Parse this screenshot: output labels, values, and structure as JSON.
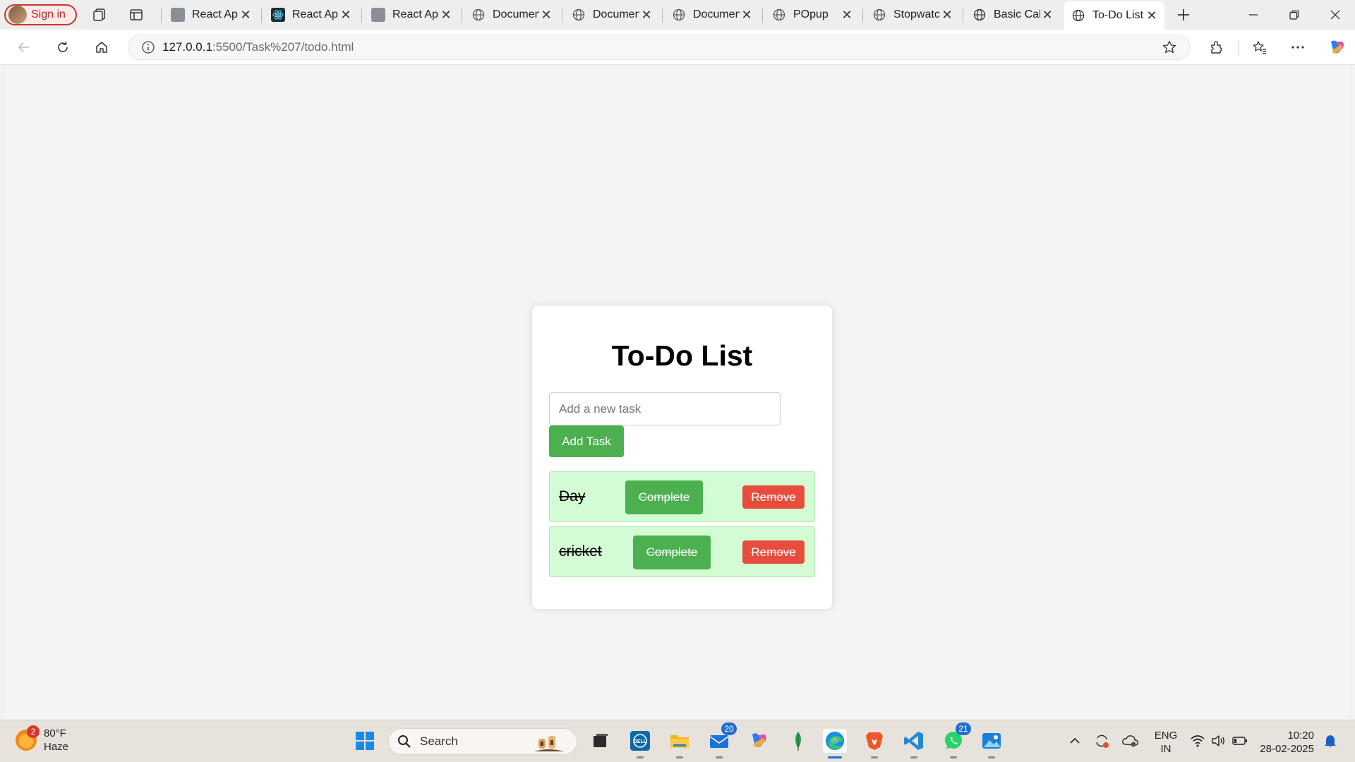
{
  "browser": {
    "sign_in_label": "Sign in",
    "tabs": [
      {
        "label": "React App",
        "icon": "react-favicon"
      },
      {
        "label": "React App",
        "icon": "react-favicon"
      },
      {
        "label": "React App",
        "icon": "react-favicon"
      },
      {
        "label": "Documen",
        "icon": "globe-icon"
      },
      {
        "label": "Documen",
        "icon": "globe-icon"
      },
      {
        "label": "Documen",
        "icon": "globe-icon"
      },
      {
        "label": "POpup",
        "icon": "globe-icon"
      },
      {
        "label": "Stopwatc",
        "icon": "globe-icon"
      },
      {
        "label": "Basic Calc",
        "icon": "globe-icon"
      },
      {
        "label": "To-Do List",
        "icon": "globe-icon",
        "active": true
      }
    ],
    "url_host": "127.0.0.1",
    "url_path": ":5500/Task%207/todo.html"
  },
  "page": {
    "title": "To-Do List",
    "input_placeholder": "Add a new task",
    "add_button_label": "Add Task",
    "tasks": [
      {
        "text": "Day",
        "complete_label": "Complete",
        "remove_label": "Remove",
        "completed": true
      },
      {
        "text": "cricket",
        "complete_label": "Complete",
        "remove_label": "Remove",
        "completed": true
      }
    ],
    "colors": {
      "add_button": "#4caf50",
      "remove_button": "#e74c3c",
      "task_bg": "#d4fcd4"
    }
  },
  "taskbar": {
    "weather_temp": "80°F",
    "weather_desc": "Haze",
    "weather_badge": "2",
    "search_label": "Search",
    "mail_badge": "20",
    "whatsapp_badge": "21",
    "lang_line1": "ENG",
    "lang_line2": "IN",
    "time": "10:20",
    "date": "28-02-2025"
  }
}
